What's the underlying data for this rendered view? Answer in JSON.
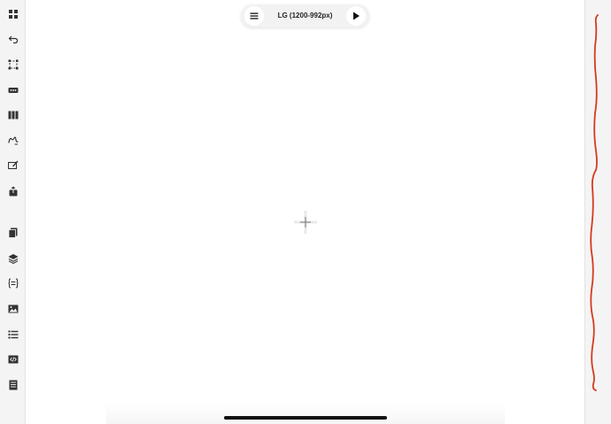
{
  "toolbar": {
    "breakpoint_label": "LG (1200-992px)",
    "menu_icon": "menu-icon",
    "play_icon": "play-icon"
  },
  "sidebar": {
    "tools": [
      "grid-icon",
      "undo-icon",
      "selection-icon",
      "more-icon",
      "columns-icon",
      "draw-icon",
      "edit-icon",
      "share-icon",
      "pages-icon",
      "layers-icon",
      "code-block-icon",
      "image-icon",
      "list-icon",
      "embed-icon",
      "document-icon"
    ]
  },
  "canvas": {
    "cursor_icon": "crosshair-icon"
  },
  "colors": {
    "sidebar_bg": "#f4f4f4",
    "canvas_bg": "#ffffff",
    "icon": "#333333",
    "stroke": "#d63a1e"
  }
}
